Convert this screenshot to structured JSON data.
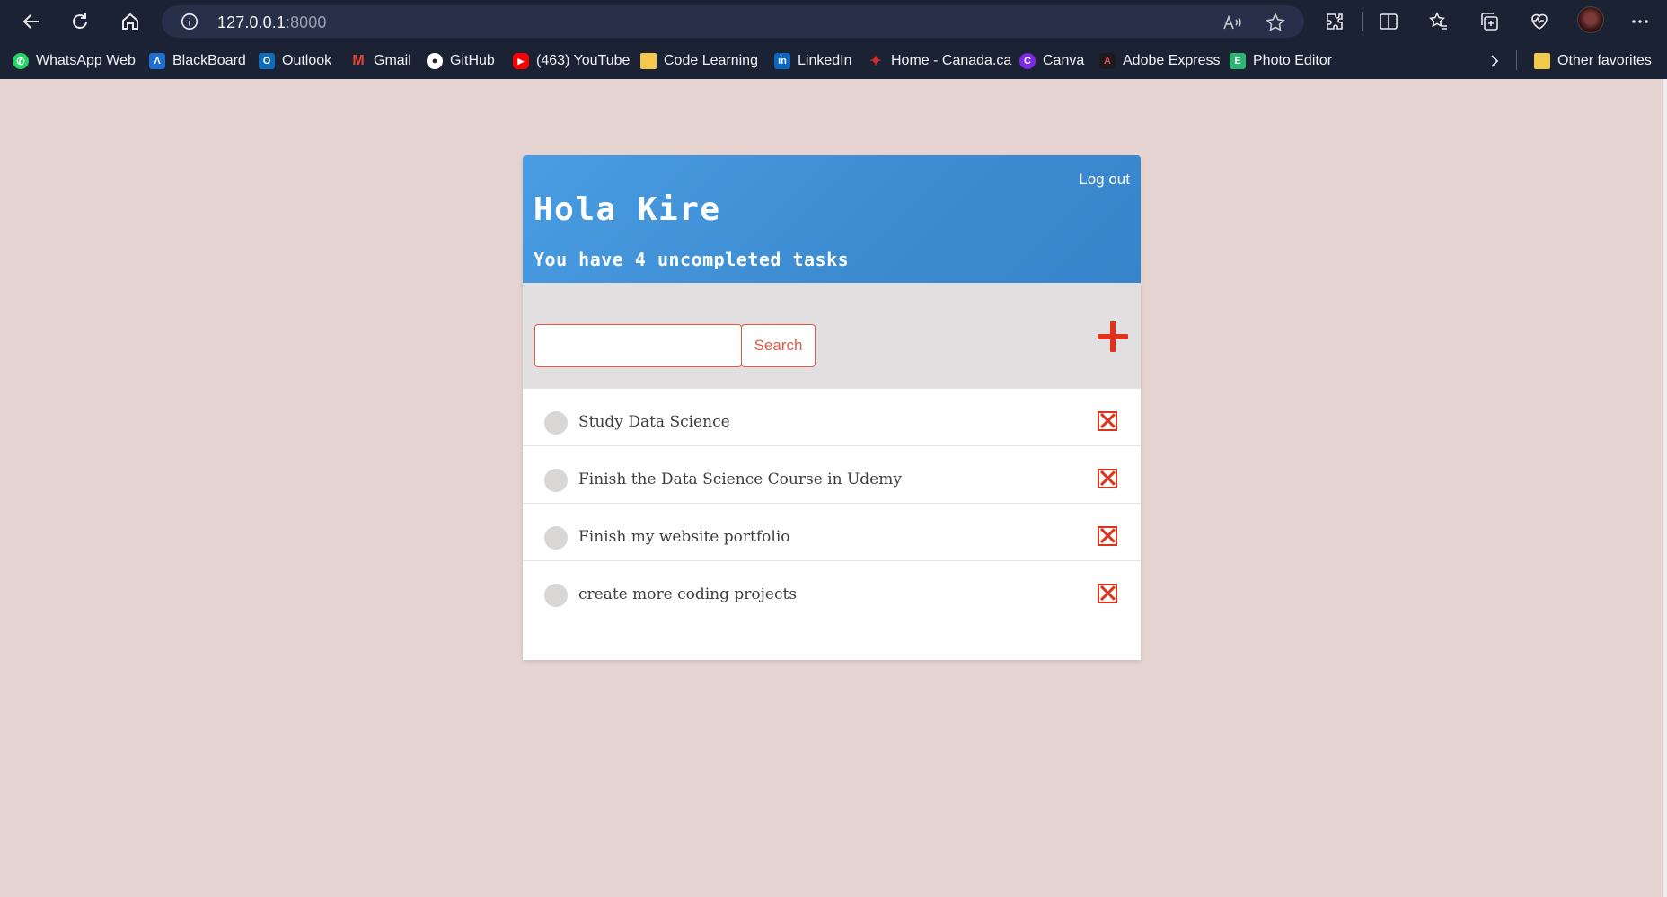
{
  "browser": {
    "url_host": "127.0.0.1",
    "url_port": ":8000",
    "bookmarks": [
      {
        "label": "WhatsApp Web",
        "icon": "whatsapp-icon",
        "color": "#25d366"
      },
      {
        "label": "BlackBoard",
        "icon": "blackboard-icon",
        "color": "#1f6fd1"
      },
      {
        "label": "Outlook",
        "icon": "outlook-icon",
        "color": "#0f6cbd"
      },
      {
        "label": "Gmail",
        "icon": "gmail-icon",
        "color": "#ea4335"
      },
      {
        "label": "GitHub",
        "icon": "github-icon",
        "color": "#ffffff"
      },
      {
        "label": "(463) YouTube",
        "icon": "youtube-icon",
        "color": "#ff0000"
      },
      {
        "label": "Code Learning",
        "icon": "folder-icon",
        "color": "#f2c94c"
      },
      {
        "label": "LinkedIn",
        "icon": "linkedin-icon",
        "color": "#0a66c2"
      },
      {
        "label": "Home - Canada.ca",
        "icon": "canada-icon",
        "color": "#d52b1e"
      },
      {
        "label": "Canva",
        "icon": "canva-icon",
        "color": "#7d2ae8"
      },
      {
        "label": "Adobe Express",
        "icon": "adobe-express-icon",
        "color": "#e34850"
      },
      {
        "label": "Photo Editor",
        "icon": "photo-editor-icon",
        "color": "#2bb673"
      }
    ],
    "other_favorites": "Other favorites"
  },
  "app": {
    "logout_label": "Log out",
    "greeting": "Hola Kire",
    "subtitle": "You have 4 uncompleted tasks",
    "search_placeholder": "",
    "search_button": "Search",
    "tasks": [
      {
        "title": "Study Data Science"
      },
      {
        "title": "Finish the Data Science Course in Udemy"
      },
      {
        "title": "Finish my website portfolio"
      },
      {
        "title": "create more coding projects"
      }
    ]
  },
  "colors": {
    "page_bg": "#e5d4d2",
    "header_blue": "#3c8bd0",
    "accent_red": "#e0311c",
    "toolbar_gray": "#e1dfdf"
  }
}
